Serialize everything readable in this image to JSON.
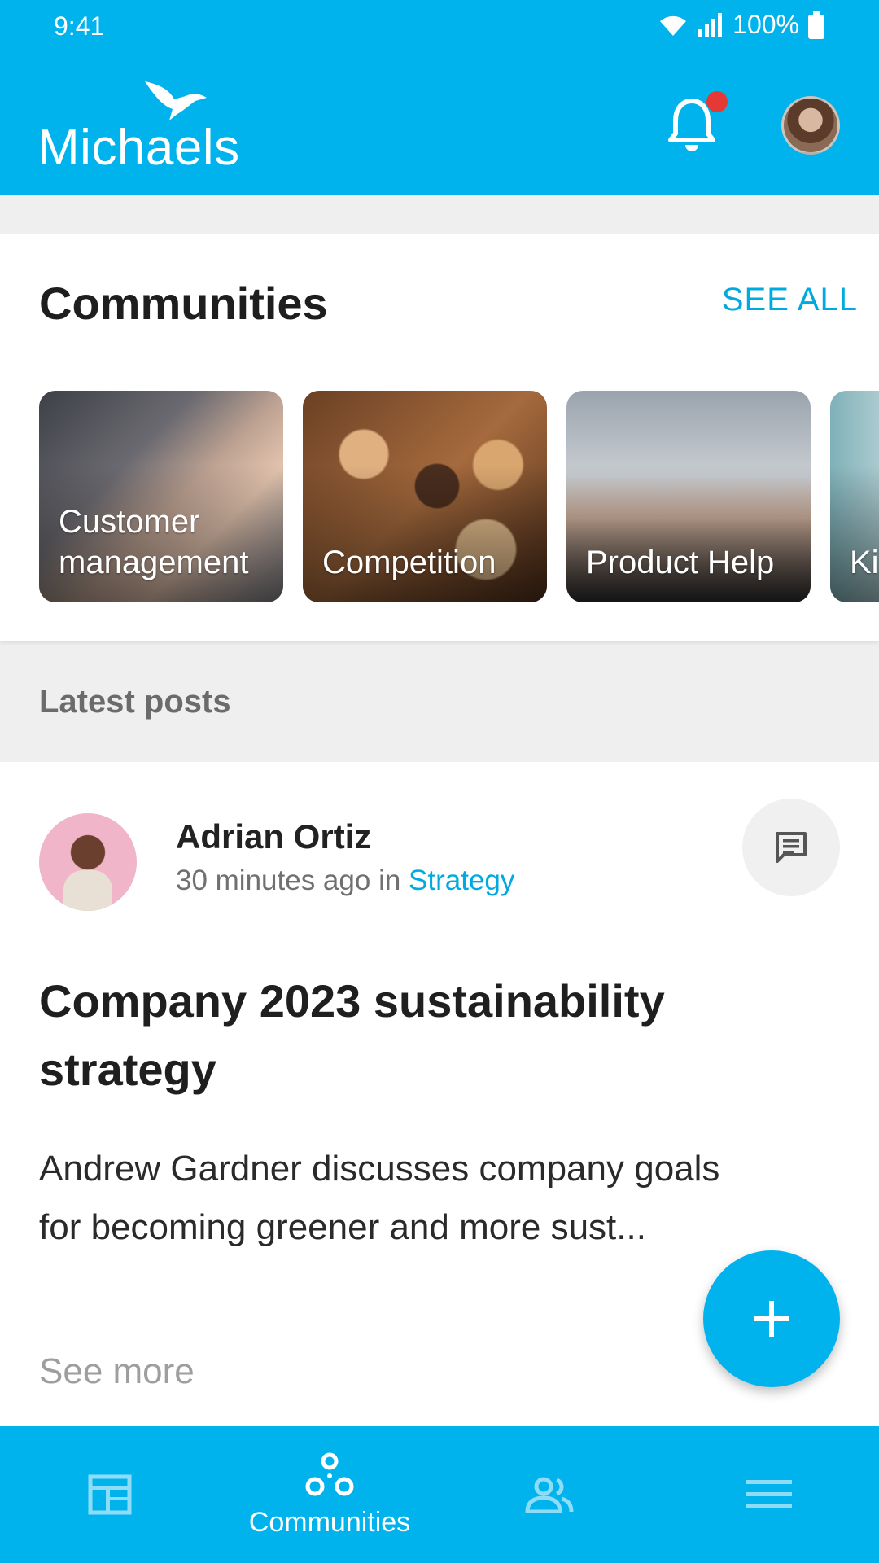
{
  "status_bar": {
    "time": "9:41",
    "battery": "100%"
  },
  "brand": {
    "name": "Michaels"
  },
  "header": {
    "has_unread_notifications": true
  },
  "communities": {
    "title": "Communities",
    "see_all": "SEE ALL",
    "tiles": [
      {
        "line1": "Customer",
        "line2": "management"
      },
      {
        "line1": "",
        "line2": "Competition"
      },
      {
        "line1": "",
        "line2": "Product Help"
      },
      {
        "line1": "",
        "line2": "Ki"
      }
    ]
  },
  "latest_posts": {
    "label": "Latest posts"
  },
  "post": {
    "author": "Adrian Ortiz",
    "time": "30 minutes ago",
    "in_text": "in",
    "community": "Strategy",
    "title": "Company 2023 sustainability strategy",
    "body": "Andrew Gardner discusses company goals for becoming greener and more sust...",
    "see_more": "See more"
  },
  "bottom_nav": {
    "items": [
      {
        "icon": "feed-icon",
        "label": ""
      },
      {
        "icon": "communities-icon",
        "label": "Communities"
      },
      {
        "icon": "people-icon",
        "label": ""
      },
      {
        "icon": "menu-icon",
        "label": ""
      }
    ],
    "active_index": 1
  },
  "colors": {
    "brand": "#00b3ec",
    "link": "#00a9e0",
    "badge": "#e53935"
  }
}
